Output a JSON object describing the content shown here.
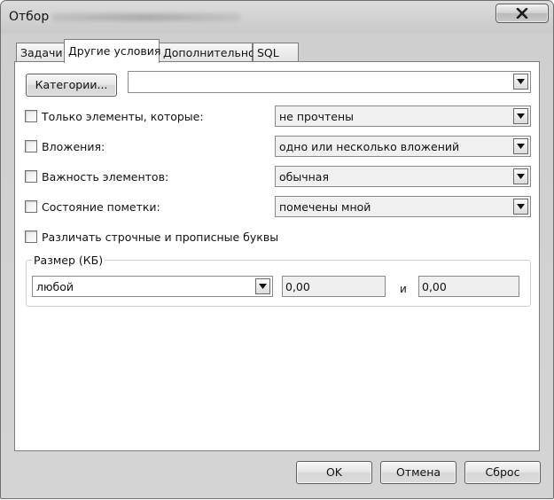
{
  "window": {
    "title": "Отбор"
  },
  "tabs": [
    {
      "label": "Задачи"
    },
    {
      "label": "Другие условия"
    },
    {
      "label": "Дополнительно"
    },
    {
      "label": "SQL"
    }
  ],
  "categories": {
    "button_label": "Категории...",
    "value": ""
  },
  "conditions": [
    {
      "label": "Только элементы, которые:",
      "value": "не прочтены"
    },
    {
      "label": "Вложения:",
      "value": "одно или несколько вложений"
    },
    {
      "label": "Важность элементов:",
      "value": "обычная"
    },
    {
      "label": "Состояние пометки:",
      "value": "помечены мной"
    }
  ],
  "case_sensitive": {
    "label": "Различать строчные и прописные буквы"
  },
  "size": {
    "group_label": "Размер (КБ)",
    "mode": "любой",
    "from": "0,00",
    "and_label": "и",
    "to": "0,00"
  },
  "footer": {
    "ok": "OK",
    "cancel": "Отмена",
    "reset": "Сброс"
  }
}
